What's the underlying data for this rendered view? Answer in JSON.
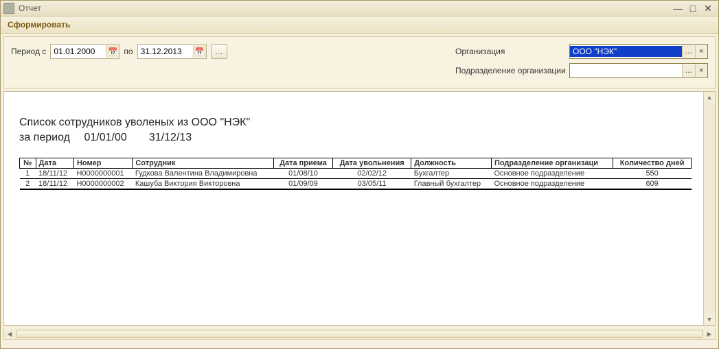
{
  "window": {
    "title": "Отчет"
  },
  "toolbar": {
    "generate_label": "Сформировать"
  },
  "filters": {
    "period_from_label": "Период с",
    "period_to_label": "по",
    "date_from": "01.01.2000",
    "date_to": "31.12.2013",
    "organization_label": "Организация",
    "organization_value": "ООО \"НЭК\"",
    "department_label": "Подразделение организации",
    "department_value": ""
  },
  "report": {
    "title": "Список сотрудников уволеных из ООО \"НЭК\"",
    "period_label": "за период",
    "period_from": "01/01/00",
    "period_to": "31/12/13",
    "headers": {
      "n": "№",
      "date": "Дата",
      "number": "Номер",
      "employee": "Сотрудник",
      "hire_date": "Дата приема",
      "fire_date": "Дата увольнения",
      "position": "Должность",
      "department": "Подразделение организаци",
      "days": "Количество дней"
    },
    "rows": [
      {
        "n": "1",
        "date": "18/11/12",
        "number": "Н0000000001",
        "employee": "Гудкова Валентина Владимировна",
        "hire_date": "01/08/10",
        "fire_date": "02/02/12",
        "position": "Бухгалтер",
        "department": "Основное подразделение",
        "days": "550"
      },
      {
        "n": "2",
        "date": "18/11/12",
        "number": "Н0000000002",
        "employee": "Кашуба Виктория Викторовна",
        "hire_date": "01/09/09",
        "fire_date": "03/05/11",
        "position": "Главный бухгалтер",
        "department": "Основное подразделение",
        "days": "609"
      }
    ]
  }
}
